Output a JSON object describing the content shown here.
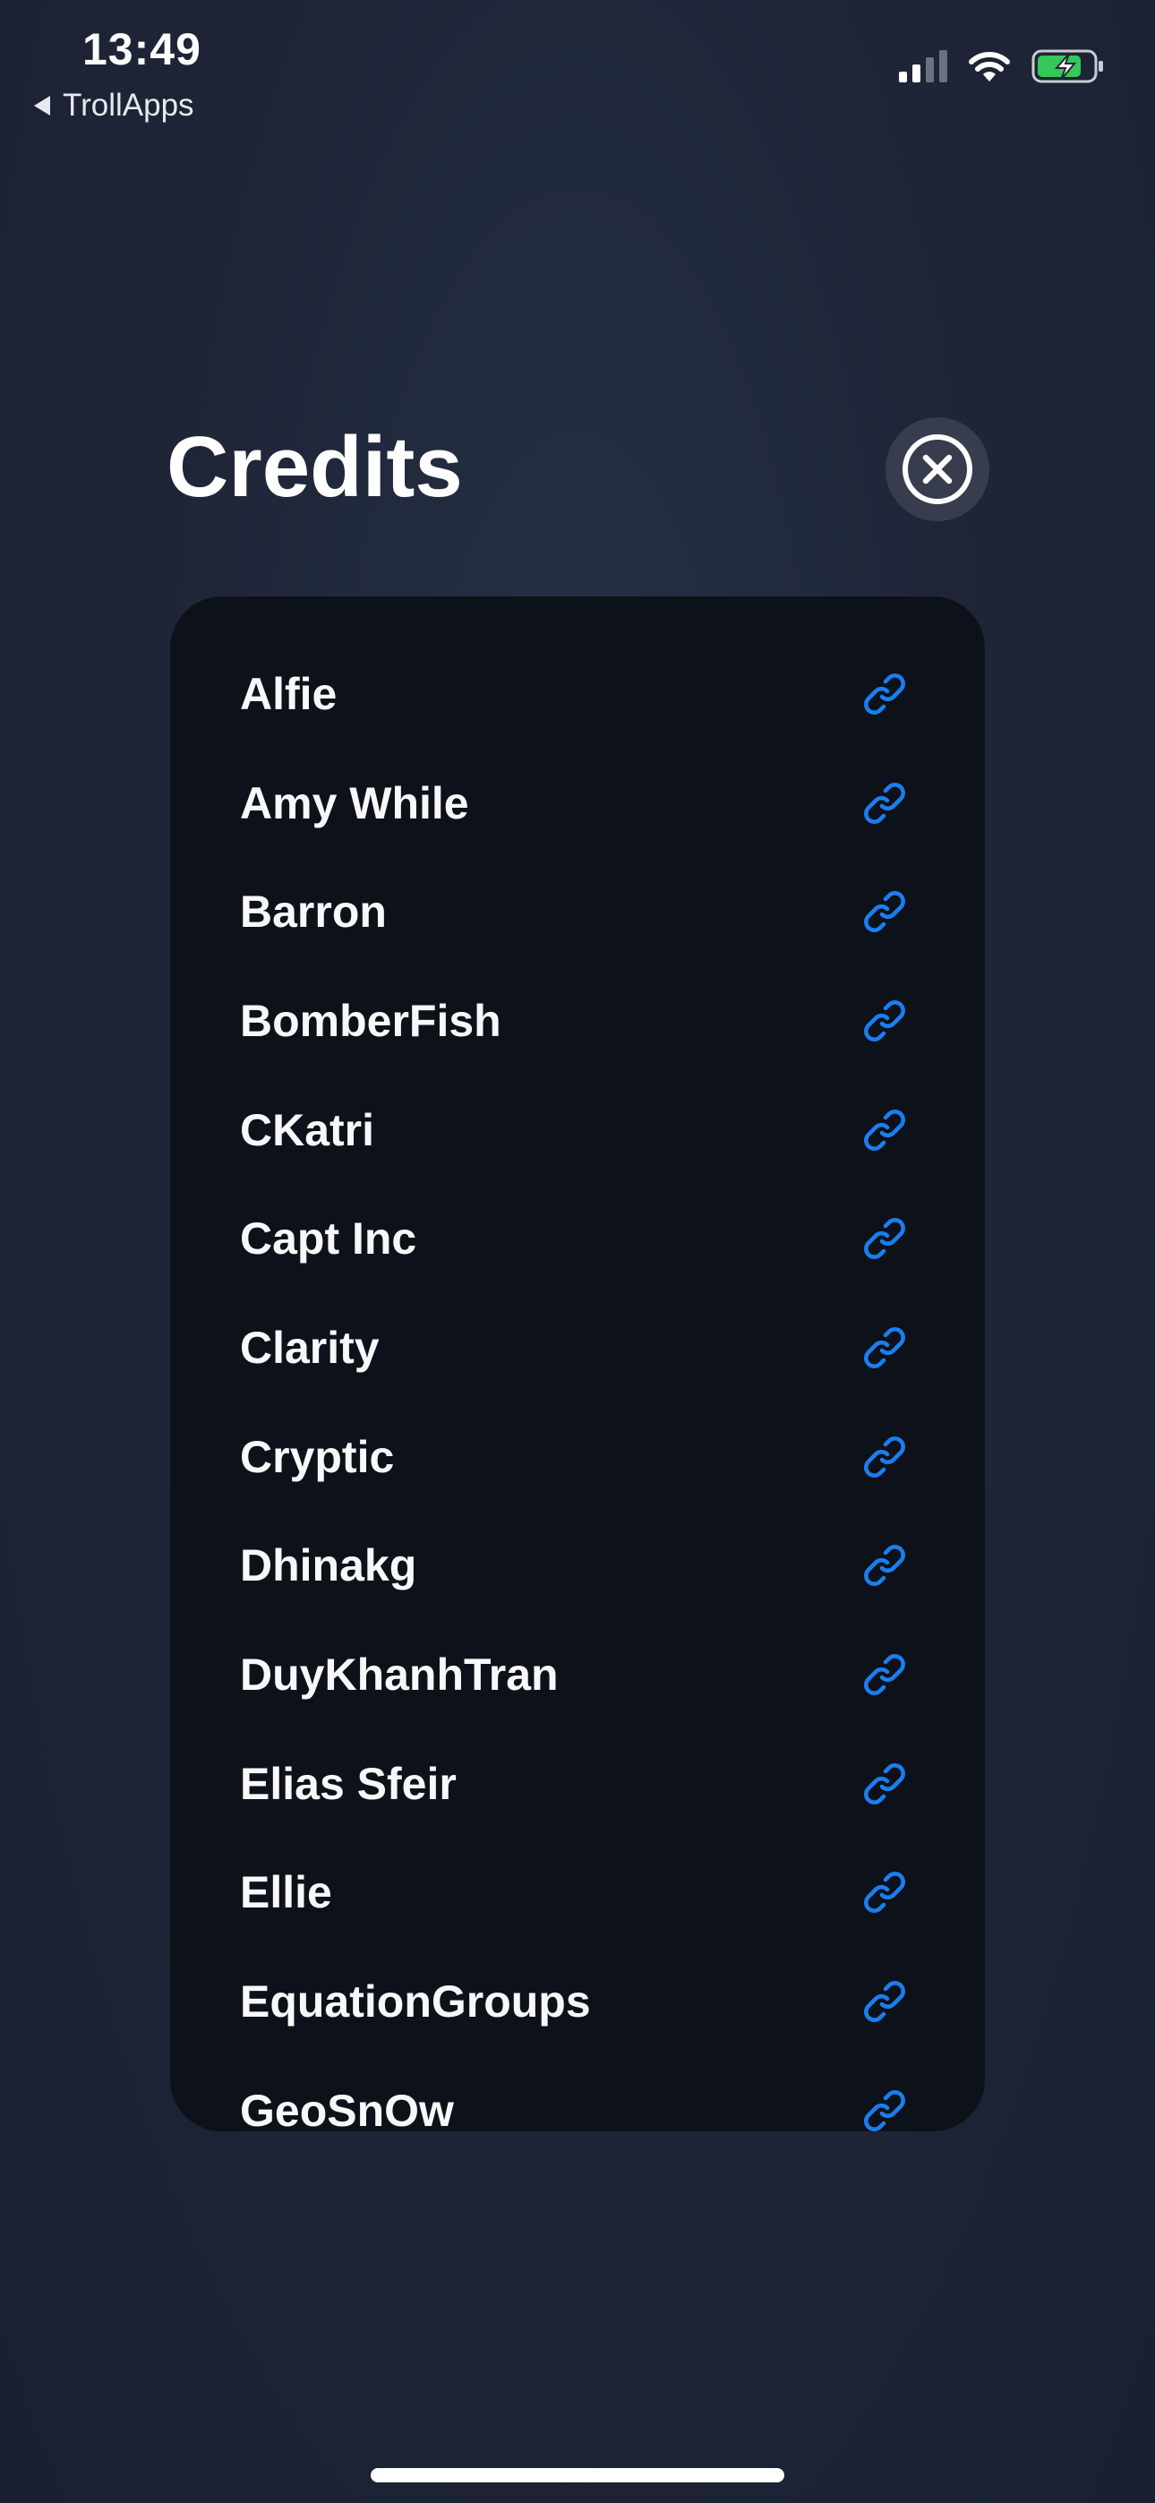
{
  "status_bar": {
    "time": "13:49",
    "back_app": "TrollApps",
    "battery_fill": 0.8
  },
  "header": {
    "title": "Credits"
  },
  "colors": {
    "accent_link": "#1a7ef0",
    "battery_green": "#34c759"
  },
  "credits": [
    {
      "name": "Alfie",
      "icon": "link-icon"
    },
    {
      "name": "Amy While",
      "icon": "link-icon"
    },
    {
      "name": "Barron",
      "icon": "link-icon"
    },
    {
      "name": "BomberFish",
      "icon": "link-icon"
    },
    {
      "name": "CKatri",
      "icon": "link-icon"
    },
    {
      "name": "Capt Inc",
      "icon": "link-icon"
    },
    {
      "name": "Clarity",
      "icon": "link-icon"
    },
    {
      "name": "Cryptic",
      "icon": "link-icon"
    },
    {
      "name": "Dhinakg",
      "icon": "link-icon"
    },
    {
      "name": "DuyKhanhTran",
      "icon": "link-icon"
    },
    {
      "name": "Elias Sfeir",
      "icon": "link-icon"
    },
    {
      "name": "Ellie",
      "icon": "link-icon"
    },
    {
      "name": "EquationGroups",
      "icon": "link-icon"
    },
    {
      "name": "GeoSnOw",
      "icon": "link-icon"
    }
  ]
}
